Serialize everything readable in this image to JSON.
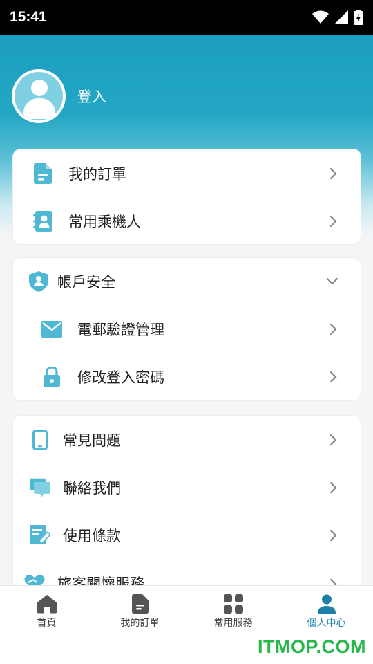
{
  "status_bar": {
    "time": "15:41"
  },
  "profile": {
    "login_label": "登入"
  },
  "orders_card": {
    "items": [
      {
        "label": "我的訂單",
        "icon": "document-icon"
      },
      {
        "label": "常用乘機人",
        "icon": "contact-book-icon"
      }
    ]
  },
  "security_card": {
    "header": {
      "label": "帳戶安全",
      "icon": "shield-user-icon",
      "expanded": true
    },
    "items": [
      {
        "label": "電郵驗證管理",
        "icon": "mail-icon"
      },
      {
        "label": "修改登入密碼",
        "icon": "lock-icon"
      }
    ]
  },
  "help_card": {
    "items": [
      {
        "label": "常見問題",
        "icon": "phone-icon"
      },
      {
        "label": "聯絡我們",
        "icon": "chat-icon"
      },
      {
        "label": "使用條款",
        "icon": "edit-document-icon"
      },
      {
        "label": "旅客關懷服務",
        "icon": "heart-hands-icon"
      }
    ]
  },
  "bottom_nav": {
    "items": [
      {
        "label": "首頁",
        "icon": "home-icon"
      },
      {
        "label": "我的訂單",
        "icon": "document-icon"
      },
      {
        "label": "常用服務",
        "icon": "grid-icon"
      },
      {
        "label": "個人中心",
        "icon": "person-icon",
        "active": true
      }
    ]
  },
  "watermark": "ITMOP.COM",
  "colors": {
    "accent": "#23a7c5",
    "icon_teal": "#4fb9d4",
    "active_nav": "#1c7fa8",
    "watermark_green": "#27b84a"
  }
}
